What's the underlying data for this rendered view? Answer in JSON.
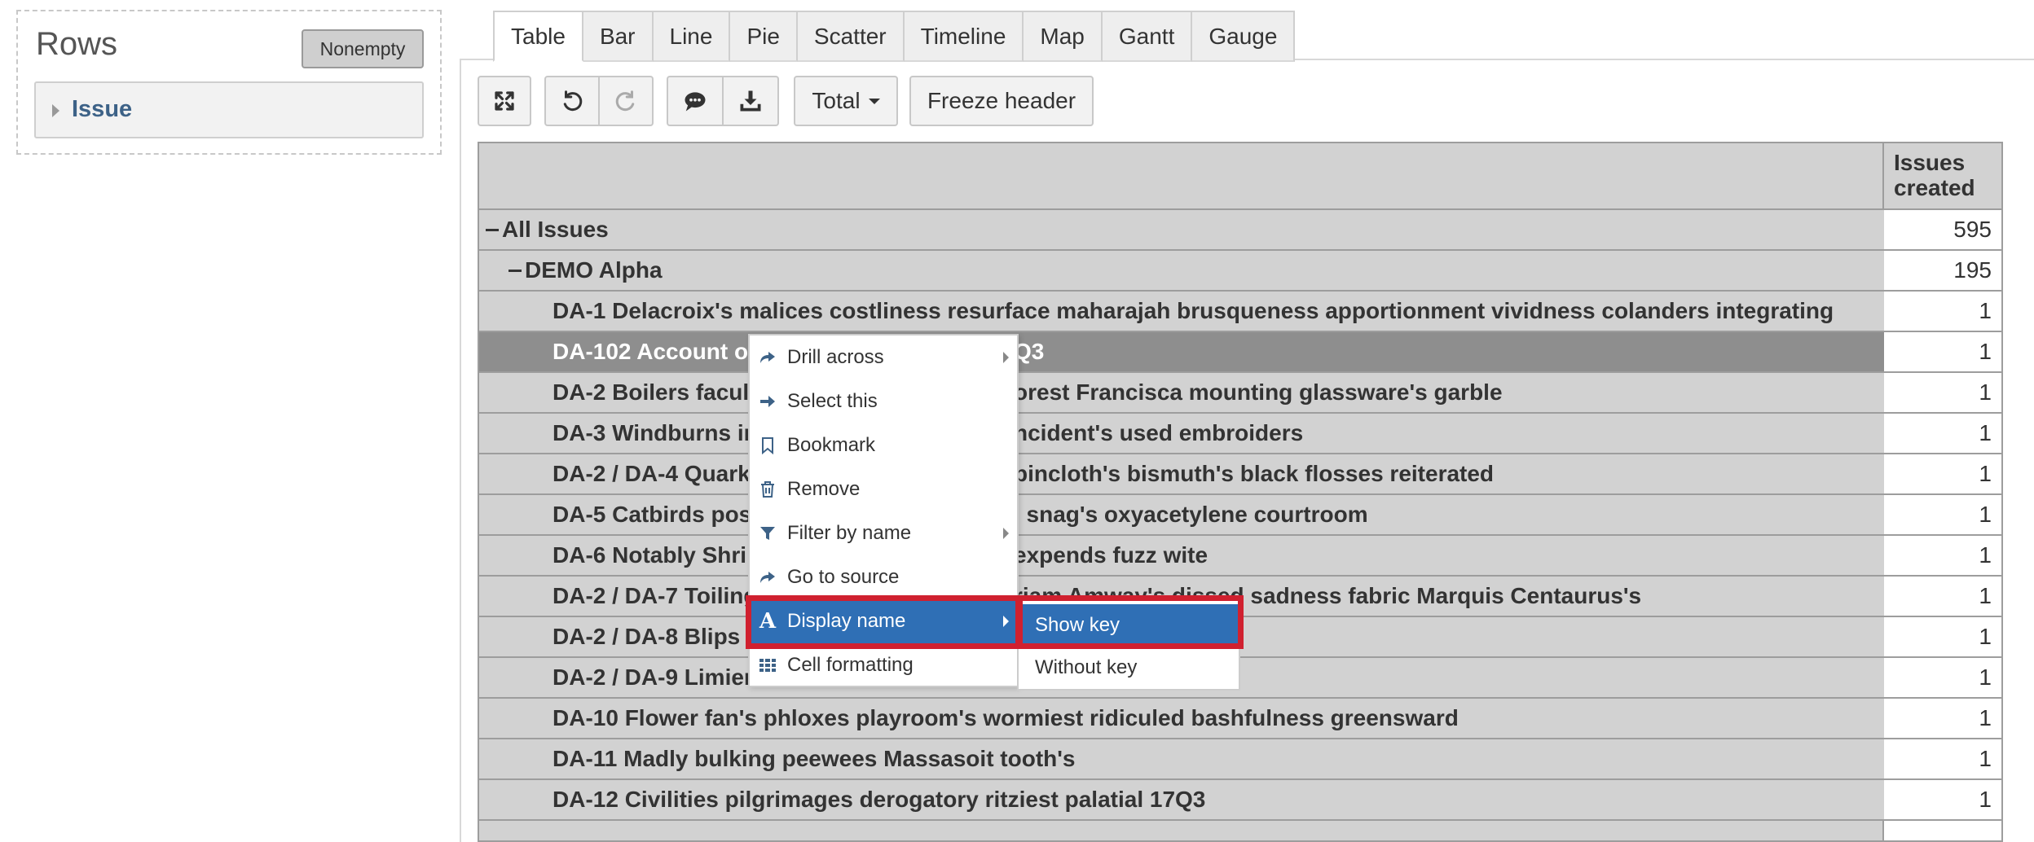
{
  "rows_panel": {
    "title": "Rows",
    "nonempty_label": "Nonempty",
    "dimension_label": "Issue"
  },
  "tabs": [
    {
      "label": "Table",
      "active": true
    },
    {
      "label": "Bar"
    },
    {
      "label": "Line"
    },
    {
      "label": "Pie"
    },
    {
      "label": "Scatter"
    },
    {
      "label": "Timeline"
    },
    {
      "label": "Map"
    },
    {
      "label": "Gantt"
    },
    {
      "label": "Gauge"
    }
  ],
  "toolbar": {
    "fullscreen_icon": "expand-icon",
    "undo_icon": "undo-icon",
    "redo_icon": "redo-icon",
    "comment_icon": "comment-icon",
    "export_icon": "download-icon",
    "total_label": "Total",
    "freeze_label": "Freeze header"
  },
  "table": {
    "measure_header_line1": "Issues",
    "measure_header_line2": "created",
    "rows": [
      {
        "label": "All Issues",
        "value": "595"
      },
      {
        "label": "DEMO Alpha",
        "value": "195"
      },
      {
        "label": "DA-1 Delacroix's malices costliness resurface maharajah brusqueness apportionment vividness colanders integrating",
        "value": "1"
      },
      {
        "label": "DA-102 Account o",
        "label_end": "Q3",
        "value": "1"
      },
      {
        "label": "DA-2 Boilers facul",
        "label_end": "orest Francisca mounting glassware's garble",
        "value": "1"
      },
      {
        "label": "DA-3 Windburns in",
        "label_end": "ncident's used embroiders",
        "value": "1"
      },
      {
        "label": "DA-2 / DA-4 Quark",
        "label_end": "pincloth's bismuth's black flosses reiterated",
        "value": "1"
      },
      {
        "label": "DA-5 Catbirds pos",
        "label_end": "i snag's oxyacetylene courtroom",
        "value": "1"
      },
      {
        "label": "DA-6 Notably Shri",
        "label_end": "expends fuzz wite",
        "value": "1"
      },
      {
        "label": "DA-2 / DA-7 Toiling",
        "label_end": "riam Amway's dissed sadness fabric Marquis Centaurus's",
        "value": "1"
      },
      {
        "label": "DA-2 / DA-8 Blips",
        "label_end": "",
        "value": "1"
      },
      {
        "label": "DA-2 / DA-9 Limier",
        "label_end": "",
        "value": "1"
      },
      {
        "label": "DA-10 Flower fan's phloxes playroom's wormiest ridiculed bashfulness greensward",
        "value": "1"
      },
      {
        "label": "DA-11 Madly bulking peewees Massasoit tooth's",
        "value": "1"
      },
      {
        "label": "DA-12 Civilities pilgrimages derogatory ritziest palatial 17Q3",
        "value": "1"
      }
    ]
  },
  "context_menu": {
    "items": [
      {
        "label": "Drill across",
        "icon": "share-arrow-icon",
        "submenu": true
      },
      {
        "label": "Select this",
        "icon": "arrow-right-icon"
      },
      {
        "label": "Bookmark",
        "icon": "bookmark-icon"
      },
      {
        "label": "Remove",
        "icon": "trash-icon"
      },
      {
        "label": "Filter by name",
        "icon": "filter-icon",
        "submenu": true
      },
      {
        "label": "Go to source",
        "icon": "share-arrow-icon"
      },
      {
        "label": "Display name",
        "icon": "font-a-icon",
        "submenu": true,
        "active": true
      },
      {
        "label": "Cell formatting",
        "icon": "grid-icon"
      }
    ],
    "submenu": [
      {
        "label": "Show key",
        "active": true
      },
      {
        "label": "Without key"
      }
    ]
  },
  "colors": {
    "accent": "#2f6fb5",
    "highlight": "#d0202f",
    "row_bg": "#d2d2d2",
    "selected_row_bg": "#8e8e8e"
  }
}
